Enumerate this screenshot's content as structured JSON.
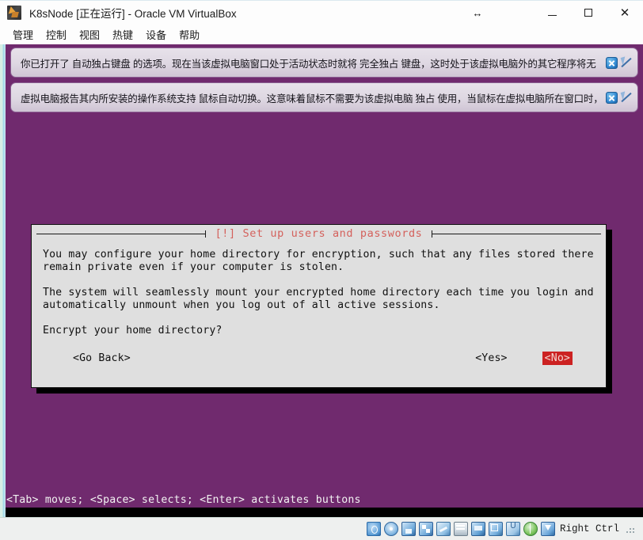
{
  "window": {
    "title": "K8sNode [正在运行] - Oracle VM VirtualBox",
    "app_icon": "virtualbox-icon",
    "controls": {
      "resize": "↔",
      "minimize": "minimize-icon",
      "maximize": "maximize-icon",
      "close": "✕"
    }
  },
  "menubar": {
    "items": [
      {
        "label": "管理"
      },
      {
        "label": "控制"
      },
      {
        "label": "视图"
      },
      {
        "label": "热键"
      },
      {
        "label": "设备"
      },
      {
        "label": "帮助"
      }
    ]
  },
  "notifications": [
    {
      "text": "你已打开了 自动独占键盘 的选项。现在当该虚拟电脑窗口处于活动状态时就将 完全独占 键盘，这时处于该虚拟电脑外的其它程序将无",
      "close_icon": "close-icon",
      "dismiss_icon": "cursor-disabled-icon"
    },
    {
      "text": "虚拟电脑报告其内所安装的操作系统支持 鼠标自动切换。这意味着鼠标不需要为该虚拟电脑 独占 使用，当鼠标在虚拟电脑所在窗口时，",
      "close_icon": "close-icon",
      "dismiss_icon": "cursor-disabled-icon"
    }
  ],
  "dialog": {
    "title": "[!] Set up users and passwords",
    "title_color": "#d4615c",
    "paragraphs": [
      "You may configure your home directory for encryption, such that any files stored there\nremain private even if your computer is stolen.",
      "The system will seamlessly mount your encrypted home directory each time you login and\nautomatically unmount when you log out of all active sessions.",
      "Encrypt your home directory?"
    ],
    "buttons": {
      "go_back": "<Go Back>",
      "yes": "<Yes>",
      "no": "<No>",
      "no_selected_bg": "#cc2222",
      "no_selected_fg": "#f4d7d2"
    }
  },
  "vm_screen": {
    "background_color": "#702a6e",
    "hint_line": "<Tab> moves; <Space> selects; <Enter> activates buttons"
  },
  "statusbar": {
    "icons": [
      "hard-disk-icon",
      "optical-disk-icon",
      "floppy-disk-icon",
      "network-icon",
      "usb-icon",
      "shared-folders-icon",
      "display-icon",
      "recording-icon",
      "vrdp-icon",
      "globe-icon",
      "host-key-icon"
    ],
    "host_key_label": "Right Ctrl"
  }
}
